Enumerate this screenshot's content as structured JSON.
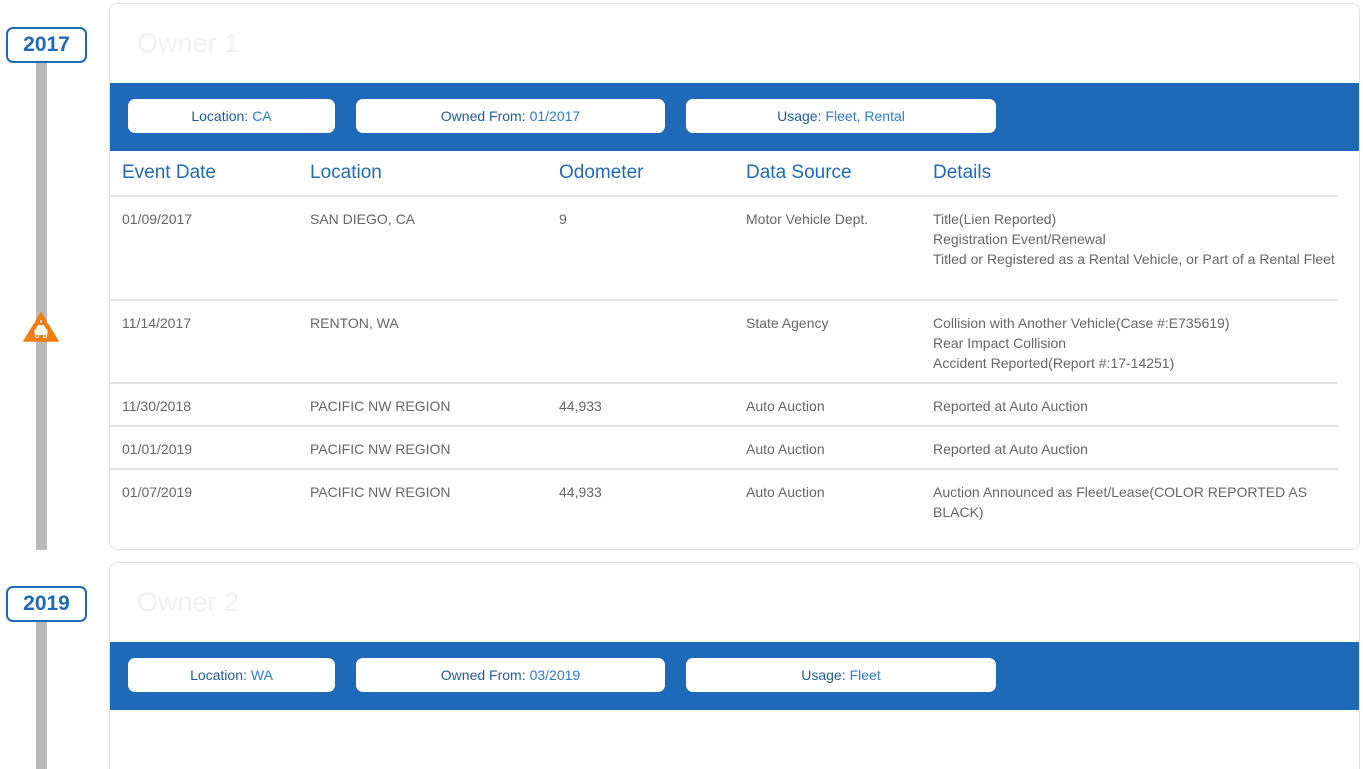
{
  "timeline": {
    "years": [
      "2017",
      "2019"
    ]
  },
  "owners": [
    {
      "title": "Owner 1",
      "location_label": "Location:",
      "location_value": "CA",
      "owned_from_label": "Owned From:",
      "owned_from_value": "01/2017",
      "usage_label": "Usage:",
      "usage_value": "Fleet, Rental",
      "columns": [
        "Event Date",
        "Location",
        "Odometer",
        "Data Source",
        "Details"
      ],
      "events": [
        {
          "date": "01/09/2017",
          "location": "SAN DIEGO, CA",
          "odometer": "9",
          "source": "Motor Vehicle Dept.",
          "details": [
            "Title(Lien Reported)",
            "Registration Event/Renewal",
            "Titled or Registered as a Rental Vehicle, or Part of a Rental Fleet"
          ]
        },
        {
          "date": "11/14/2017",
          "location": "RENTON, WA",
          "odometer": "",
          "source": "State Agency",
          "details": [
            "Collision with Another Vehicle(Case #:E735619)",
            "Rear Impact Collision",
            "Accident Reported(Report #:17-14251)"
          ]
        },
        {
          "date": "11/30/2018",
          "location": "PACIFIC NW REGION",
          "odometer": "44,933",
          "source": "Auto Auction",
          "details": [
            "Reported at Auto Auction"
          ]
        },
        {
          "date": "01/01/2019",
          "location": "PACIFIC NW REGION",
          "odometer": "",
          "source": "Auto Auction",
          "details": [
            "Reported at Auto Auction"
          ]
        },
        {
          "date": "01/07/2019",
          "location": "PACIFIC NW REGION",
          "odometer": "44,933",
          "source": "Auto Auction",
          "details": [
            "Auction Announced as Fleet/Lease(COLOR REPORTED AS BLACK)"
          ]
        }
      ]
    },
    {
      "title": "Owner 2",
      "location_label": "Location:",
      "location_value": "WA",
      "owned_from_label": "Owned From:",
      "owned_from_value": "03/2019",
      "usage_label": "Usage:",
      "usage_value": "Fleet"
    }
  ],
  "icons": {
    "accident_marker": "car-accident-warning-icon"
  },
  "colors": {
    "accent": "#1f6ab8",
    "warning": "#f07d12",
    "rail": "#b9b9b9"
  }
}
